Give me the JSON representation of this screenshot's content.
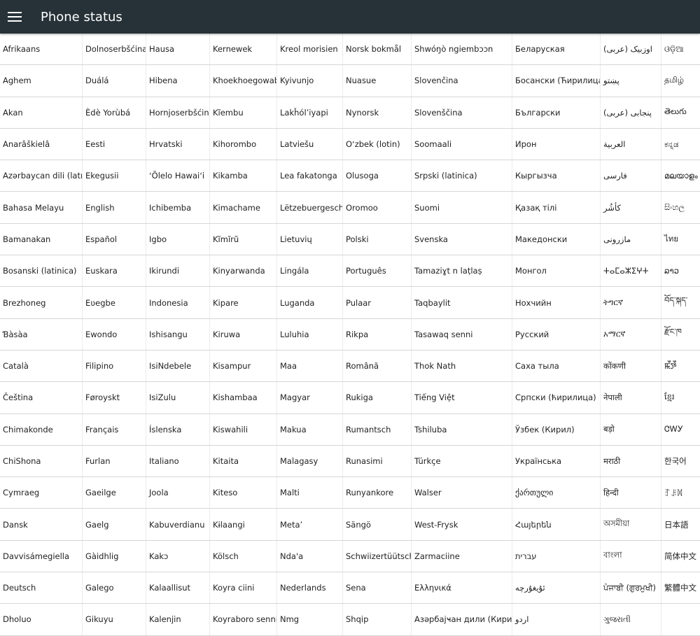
{
  "appbar": {
    "title": "Phone status",
    "menu_icon": "hamburger-menu-icon",
    "background": "#263238"
  },
  "languages": [
    [
      "Afrikaans",
      "Dolnoserbšćina",
      "Hausa",
      "Kernewek",
      "Kreol morisien",
      "Norsk bokmål",
      "Shwóŋò ngiembɔɔn",
      "Беларуская",
      "اوزبیک (عربی)",
      "ଓଡ଼ିଆ"
    ],
    [
      "Aghem",
      "Duálá",
      "Hibena",
      "Khoekhoegowab",
      "Kyivunjo",
      "Nuasue",
      "Slovenčina",
      "Босански (Ћирилица)",
      "پښتو",
      "தமிழ்"
    ],
    [
      "Akan",
      "Èdè Yorùbá",
      "Hornjoserbšćina",
      "Kĩembu",
      "Lakȟólʼiyapi",
      "Nynorsk",
      "Slovenščina",
      "Български",
      "پنجابی (عربی)",
      "తెలుగు"
    ],
    [
      "Anarâškielâ",
      "Eesti",
      "Hrvatski",
      "Kihorombo",
      "Latviešu",
      "Oʻzbek (lotin)",
      "Soomaali",
      "Ирон",
      "العربية",
      "ಕನ್ನಡ"
    ],
    [
      "Azərbaycan dili (latın)",
      "Ekegusii",
      "ʻŌlelo Hawaiʻi",
      "Kikamba",
      "Lea fakatonga",
      "Olusoga",
      "Srpski (latinica)",
      "Кыргызча",
      "فارسی",
      "മലയാളം"
    ],
    [
      "Bahasa Melayu",
      "English",
      "Ichibemba",
      "Kimachame",
      "Lëtzebuergesch",
      "Oromoo",
      "Suomi",
      "Қазақ тілі",
      "کأشُر",
      "සිංහල"
    ],
    [
      "Bamanakan",
      "Español",
      "Igbo",
      "Kĩmĩrũ",
      "Lietuvių",
      "Polski",
      "Svenska",
      "Македонски",
      "مازرونی",
      "ไทย"
    ],
    [
      "Bosanski (latinica)",
      "Euskara",
      "Ikirundi",
      "Kinyarwanda",
      "Lingála",
      "Português",
      "Tamaziɣt n laṭlaṣ",
      "Монгол",
      "ⵜⴰⵎⴰⵣⵉⵖⵜ",
      "ລາວ"
    ],
    [
      "Brezhoneg",
      "Eʋegbe",
      "Indonesia",
      "Kipare",
      "Luganda",
      "Pulaar",
      "Taqbaylit",
      "Нохчийн",
      "ትግርኛ",
      "བོད་སྐད་"
    ],
    [
      "Ɓàsàa",
      "Ewondo",
      "Ishisangu",
      "Kiruwa",
      "Luluhia",
      "Rikpa",
      "Tasawaq senni",
      "Русский",
      "አማርኛ",
      "རྫོང་ཁ"
    ],
    [
      "Català",
      "Filipino",
      "IsiNdebele",
      "Kisampur",
      "Maa",
      "Română",
      "Thok Nath",
      "Саха тыла",
      "कोंकणी",
      "ꯃꯩꯇꯩ"
    ],
    [
      "Čeština",
      "Føroyskt",
      "IsiZulu",
      "Kishambaa",
      "Magyar",
      "Rukiga",
      "Tiếng Việt",
      "Српски (ћирилица)",
      "नेपाली",
      "ខ្មែរ"
    ],
    [
      "Chimakonde",
      "Français",
      "Íslenska",
      "Kiswahili",
      "Makua",
      "Rumantsch",
      "Tshiluba",
      "Ўзбек (Кирил)",
      "बड़ो",
      "ᏣᎳᎩ"
    ],
    [
      "ChiShona",
      "Furlan",
      "Italiano",
      "Kitaita",
      "Malagasy",
      "Runasimi",
      "Türkçe",
      "Українська",
      "मराठी",
      "한국어"
    ],
    [
      "Cymraeg",
      "Gaeilge",
      "Joola",
      "Kiteso",
      "Malti",
      "Runyankore",
      "Walser",
      "ქართული",
      "हिन्दी",
      "ꆈꌠꉙ"
    ],
    [
      "Dansk",
      "Gaelg",
      "Kabuverdianu",
      "Kɨlaangi",
      "Metaʼ",
      "Sängö",
      "West-Frysk",
      "Հայերեն",
      "অসমীয়া",
      "日本語"
    ],
    [
      "Davvisámegiella",
      "Gàidhlig",
      "Kakɔ",
      "Kölsch",
      "Ndaꞌa",
      "Schwiizertüütsch",
      "Zarmaciine",
      "עברית",
      "বাংলা",
      "简体中文"
    ],
    [
      "Deutsch",
      "Galego",
      "Kalaallisut",
      "Koyra ciini",
      "Nederlands",
      "Sena",
      "Ελληνικά",
      "ئۇيغۇرچە",
      "ਪੰਜਾਬੀ (ਗੁਰਮੁਖੀ)",
      "繁體中文"
    ],
    [
      "Dholuo",
      "Gikuyu",
      "Kalenjin",
      "Koyraboro senni",
      "Nmg",
      "Shqip",
      "Азәрбајҹан дили (Кирил)",
      "اردو",
      "ગુજરાતી",
      ""
    ]
  ]
}
